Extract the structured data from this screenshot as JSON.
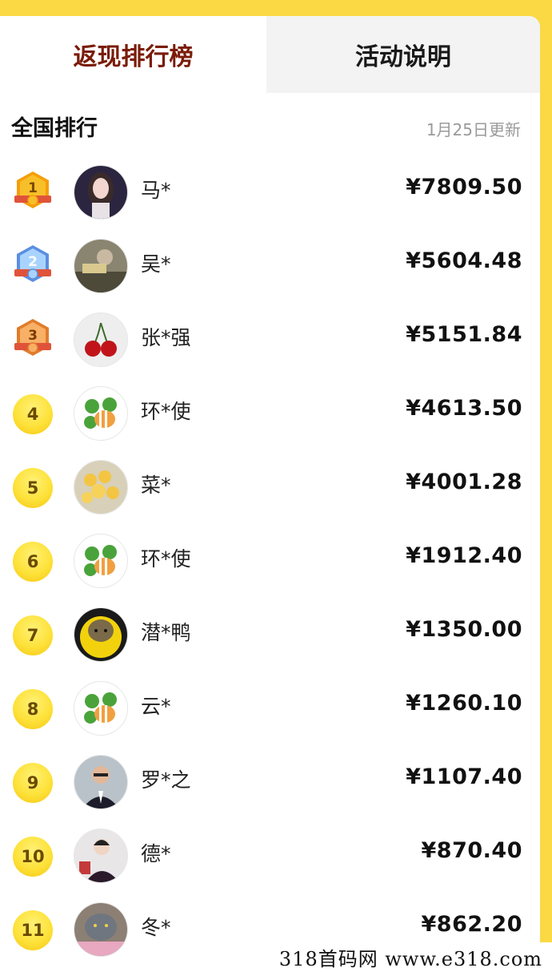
{
  "tabs": [
    {
      "label": "返现排行榜",
      "active": true
    },
    {
      "label": "活动说明",
      "active": false
    }
  ],
  "section": {
    "title": "全国排行",
    "update_note": "1月25日更新"
  },
  "ranking": [
    {
      "rank": "1",
      "badge": "gold-medal-icon",
      "avatar": "avatar-girl-portrait",
      "name": "马*",
      "amount": "¥7809.50"
    },
    {
      "rank": "2",
      "badge": "silver-medal-icon",
      "avatar": "avatar-photo-outdoor",
      "name": "吴*",
      "amount": "¥5604.48"
    },
    {
      "rank": "3",
      "badge": "bronze-medal-icon",
      "avatar": "avatar-cherries",
      "name": "张*强",
      "amount": "¥5151.84"
    },
    {
      "rank": "4",
      "badge": "rank-circle",
      "avatar": "avatar-bee-logo",
      "name": "环*使",
      "amount": "¥4613.50"
    },
    {
      "rank": "5",
      "badge": "rank-circle",
      "avatar": "avatar-yellow-flowers",
      "name": "菜*",
      "amount": "¥4001.28"
    },
    {
      "rank": "6",
      "badge": "rank-circle",
      "avatar": "avatar-bee-logo",
      "name": "环*使",
      "amount": "¥1912.40"
    },
    {
      "rank": "7",
      "badge": "rank-circle",
      "avatar": "avatar-cat-yellow",
      "name": "潜*鸭",
      "amount": "¥1350.00"
    },
    {
      "rank": "8",
      "badge": "rank-circle",
      "avatar": "avatar-bee-logo",
      "name": "云*",
      "amount": "¥1260.10"
    },
    {
      "rank": "9",
      "badge": "rank-circle",
      "avatar": "avatar-man-suit",
      "name": "罗*之",
      "amount": "¥1107.40"
    },
    {
      "rank": "10",
      "badge": "rank-circle",
      "avatar": "avatar-young-man",
      "name": "德*",
      "amount": "¥870.40"
    },
    {
      "rank": "11",
      "badge": "rank-circle",
      "avatar": "avatar-grey-cat",
      "name": "冬*",
      "amount": "¥862.20"
    }
  ],
  "watermark": "318首码网 www.e318.com",
  "colors": {
    "background": "#fbd944",
    "active_tab_text": "#7a1c08",
    "inactive_tab_bg": "#f3f3f3",
    "update_note": "#9a9a9a"
  }
}
